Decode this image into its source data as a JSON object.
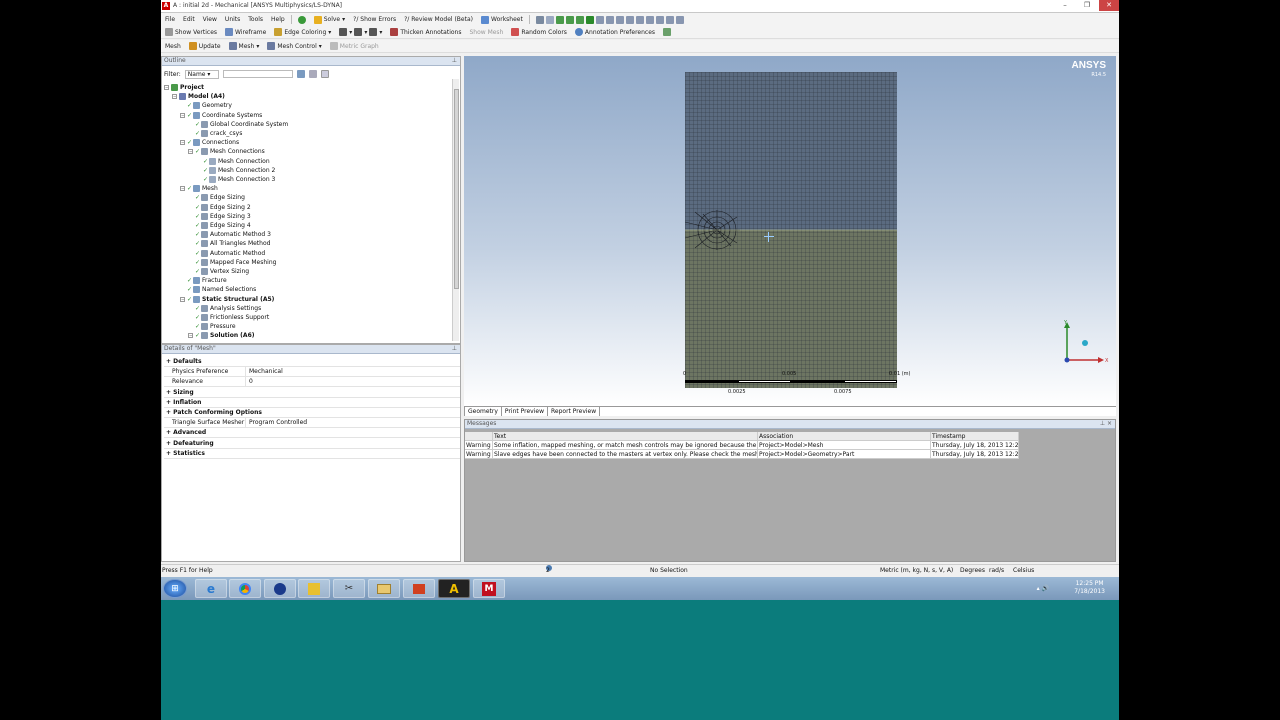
{
  "window": {
    "title": "A : initial 2d - Mechanical [ANSYS Multiphysics/LS-DYNA]"
  },
  "menu": [
    "File",
    "Edit",
    "View",
    "Units",
    "Tools",
    "Help"
  ],
  "toolbar1": {
    "solve": "Solve",
    "show_errors": "?/ Show Errors",
    "review_model": "?/ Review Model (Beta)",
    "worksheet": "Worksheet"
  },
  "toolbar2": {
    "show_vertices": "Show Vertices",
    "wireframe": "Wireframe",
    "edge_coloring": "Edge Coloring",
    "thicken": "Thicken Annotations",
    "show_mesh": "Show Mesh",
    "random_colors": "Random Colors",
    "annotation_prefs": "Annotation Preferences"
  },
  "toolbar3": {
    "mesh": "Mesh",
    "update": "Update",
    "mesh_menu": "Mesh",
    "mesh_control": "Mesh Control",
    "metric_graph": "Metric Graph"
  },
  "outline": {
    "header": "Outline",
    "filter_label": "Filter:",
    "filter_value": "Name",
    "items": [
      {
        "label": "Project",
        "level": 0,
        "bold": true
      },
      {
        "label": "Model (A4)",
        "level": 1,
        "bold": true
      },
      {
        "label": "Geometry",
        "level": 2
      },
      {
        "label": "Coordinate Systems",
        "level": 2
      },
      {
        "label": "Global Coordinate System",
        "level": 3
      },
      {
        "label": "crack_csys",
        "level": 3
      },
      {
        "label": "Connections",
        "level": 2
      },
      {
        "label": "Mesh Connections",
        "level": 3
      },
      {
        "label": "Mesh Connection",
        "level": 4
      },
      {
        "label": "Mesh Connection 2",
        "level": 4
      },
      {
        "label": "Mesh Connection 3",
        "level": 4
      },
      {
        "label": "Mesh",
        "level": 2
      },
      {
        "label": "Edge Sizing",
        "level": 3
      },
      {
        "label": "Edge Sizing 2",
        "level": 3
      },
      {
        "label": "Edge Sizing 3",
        "level": 3
      },
      {
        "label": "Edge Sizing 4",
        "level": 3
      },
      {
        "label": "Automatic Method 3",
        "level": 3
      },
      {
        "label": "All Triangles Method",
        "level": 3
      },
      {
        "label": "Automatic Method",
        "level": 3
      },
      {
        "label": "Mapped Face Meshing",
        "level": 3
      },
      {
        "label": "Vertex Sizing",
        "level": 3
      },
      {
        "label": "Fracture",
        "level": 2
      },
      {
        "label": "Named Selections",
        "level": 2
      },
      {
        "label": "Static Structural (A5)",
        "level": 2,
        "bold": true
      },
      {
        "label": "Analysis Settings",
        "level": 3
      },
      {
        "label": "Frictionless Support",
        "level": 3
      },
      {
        "label": "Pressure",
        "level": 3
      },
      {
        "label": "Solution (A6)",
        "level": 3,
        "bold": true
      }
    ]
  },
  "details": {
    "header": "Details of \"Mesh\"",
    "rows": [
      {
        "k": "Defaults",
        "v": "",
        "grp": true
      },
      {
        "k": "Physics Preference",
        "v": "Mechanical"
      },
      {
        "k": "Relevance",
        "v": "0"
      },
      {
        "k": "Sizing",
        "v": "",
        "grp": true
      },
      {
        "k": "Inflation",
        "v": "",
        "grp": true
      },
      {
        "k": "Patch Conforming Options",
        "v": "",
        "grp": true
      },
      {
        "k": "Triangle Surface Mesher",
        "v": "Program Controlled"
      },
      {
        "k": "Advanced",
        "v": "",
        "grp": true
      },
      {
        "k": "Defeaturing",
        "v": "",
        "grp": true
      },
      {
        "k": "Statistics",
        "v": "",
        "grp": true
      }
    ]
  },
  "graphics": {
    "logo": "ANSYS",
    "version": "R14.5",
    "scale_0": "0",
    "scale_1": "0.005",
    "scale_2": "0.01 (m)",
    "scale_3": "0.0025",
    "scale_4": "0.0075",
    "axis_x": "X",
    "axis_y": "Y"
  },
  "tabs": [
    "Geometry",
    "Print Preview",
    "Report Preview"
  ],
  "messages": {
    "header": "Messages",
    "cols": [
      "",
      "Text",
      "Association",
      "Timestamp"
    ],
    "rows": [
      [
        "Warning",
        "Some inflation, mapped meshing, or match mesh controls may be ignored because the",
        "Project>Model>Mesh",
        "Thursday, July 18, 2013 12:2"
      ],
      [
        "Warning",
        "Slave edges have been connected to the masters at vertex only. Please check the mesh",
        "Project>Model>Geometry>Part",
        "Thursday, July 18, 2013 12:2"
      ]
    ]
  },
  "status": {
    "help": "Press F1 for Help",
    "messages": "2 Messages",
    "selection": "No Selection",
    "units": "Metric (m, kg, N, s, V, A)",
    "degrees": "Degrees",
    "rads": "rad/s",
    "temp": "Celsius"
  },
  "taskbar": {
    "time": "12:25 PM",
    "date": "7/18/2013"
  }
}
